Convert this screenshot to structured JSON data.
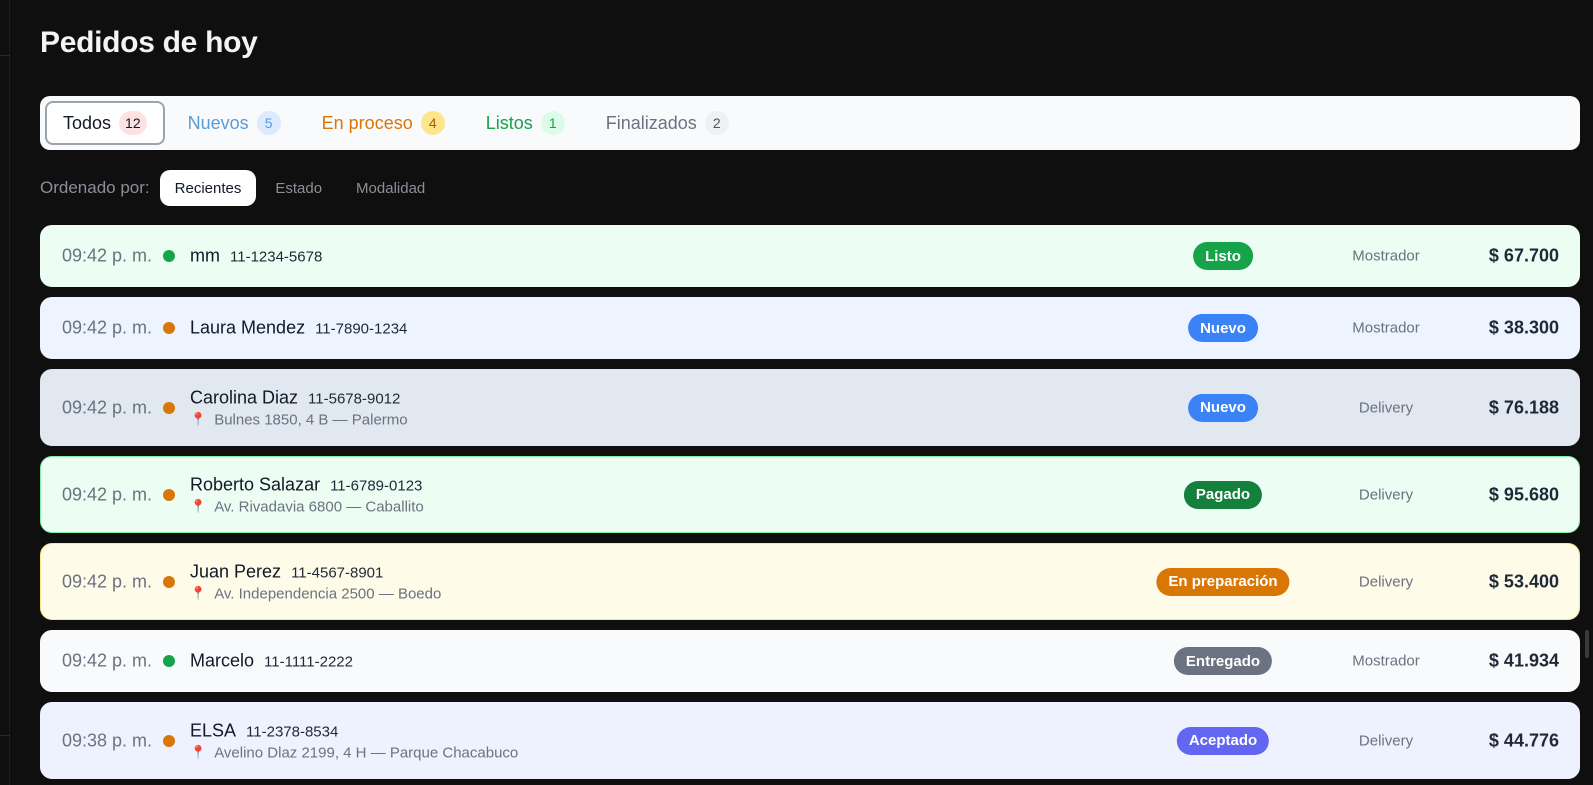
{
  "page": {
    "title": "Pedidos de hoy"
  },
  "tabs": [
    {
      "label": "Todos",
      "count": "12",
      "color": "#111827",
      "badge_bg": "#fee2e2",
      "badge_color": "#111827",
      "active": true
    },
    {
      "label": "Nuevos",
      "count": "5",
      "color": "#5b9bd5",
      "badge_bg": "#dbeafe",
      "badge_color": "#5b9bd5",
      "active": false
    },
    {
      "label": "En proceso",
      "count": "4",
      "color": "#d97706",
      "badge_bg": "#fde68a",
      "badge_color": "#b45309",
      "active": false
    },
    {
      "label": "Listos",
      "count": "1",
      "color": "#16a34a",
      "badge_bg": "#dcfce7",
      "badge_color": "#16a34a",
      "active": false
    },
    {
      "label": "Finalizados",
      "count": "2",
      "color": "#6b7280",
      "badge_bg": "#eef0f3",
      "badge_color": "#4b5563",
      "active": false
    }
  ],
  "sort": {
    "label": "Ordenado por:",
    "options": [
      {
        "label": "Recientes",
        "active": true
      },
      {
        "label": "Estado",
        "active": false
      },
      {
        "label": "Modalidad",
        "active": false
      }
    ]
  },
  "orders": [
    {
      "time": "09:42 p. m.",
      "dot_color": "#16a34a",
      "name": "mm",
      "phone": "11-1234-5678",
      "address": "",
      "status": "Listo",
      "status_color": "#16a34a",
      "mode": "Mostrador",
      "total": "$ 67.700",
      "row_bg": "#ecfdf3",
      "row_border": "#ecfdf3"
    },
    {
      "time": "09:42 p. m.",
      "dot_color": "#d97706",
      "name": "Laura Mendez",
      "phone": "11-7890-1234",
      "address": "",
      "status": "Nuevo",
      "status_color": "#3b82f6",
      "mode": "Mostrador",
      "total": "$ 38.300",
      "row_bg": "#eef4ff",
      "row_border": "#eef4ff"
    },
    {
      "time": "09:42 p. m.",
      "dot_color": "#d97706",
      "name": "Carolina Diaz",
      "phone": "11-5678-9012",
      "address": "Bulnes 1850, 4 B — Palermo",
      "status": "Nuevo",
      "status_color": "#3b82f6",
      "mode": "Delivery",
      "total": "$ 76.188",
      "row_bg": "#e2e8f0",
      "row_border": "#e2e8f0"
    },
    {
      "time": "09:42 p. m.",
      "dot_color": "#d97706",
      "name": "Roberto Salazar",
      "phone": "11-6789-0123",
      "address": "Av. Rivadavia 6800 — Caballito",
      "status": "Pagado",
      "status_color": "#15803d",
      "mode": "Delivery",
      "total": "$ 95.680",
      "row_bg": "#ecfdf3",
      "row_border": "#86efac"
    },
    {
      "time": "09:42 p. m.",
      "dot_color": "#d97706",
      "name": "Juan Perez",
      "phone": "11-4567-8901",
      "address": "Av. Independencia 2500 — Boedo",
      "status": "En preparación",
      "status_color": "#d97706",
      "mode": "Delivery",
      "total": "$ 53.400",
      "row_bg": "#fefbe8",
      "row_border": "#fde68a"
    },
    {
      "time": "09:42 p. m.",
      "dot_color": "#16a34a",
      "name": "Marcelo",
      "phone": "11-1111-2222",
      "address": "",
      "status": "Entregado",
      "status_color": "#6b7280",
      "mode": "Mostrador",
      "total": "$ 41.934",
      "row_bg": "#f8fafc",
      "row_border": "#f8fafc"
    },
    {
      "time": "09:38 p. m.",
      "dot_color": "#d97706",
      "name": "ELSA",
      "phone": "11-2378-8534",
      "address": "Avelino Dlaz 2199, 4 H — Parque Chacabuco",
      "status": "Aceptado",
      "status_color": "#6366f1",
      "mode": "Delivery",
      "total": "$ 44.776",
      "row_bg": "#eef2ff",
      "row_border": "#eef2ff"
    }
  ]
}
